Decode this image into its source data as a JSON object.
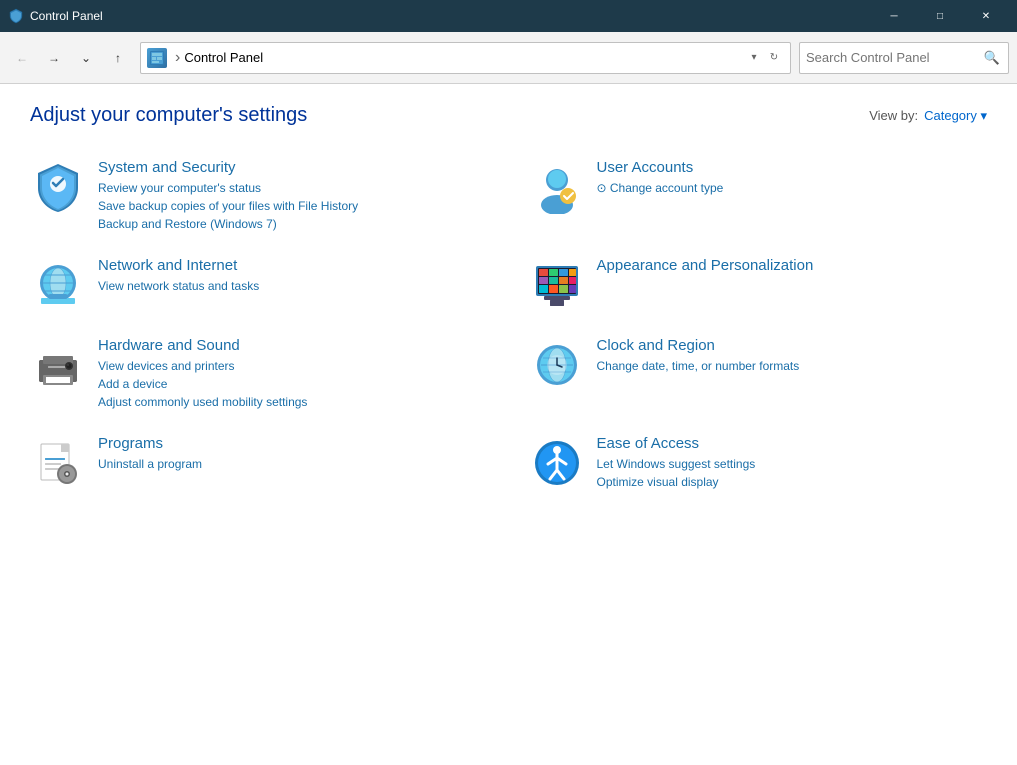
{
  "titlebar": {
    "title": "Control Panel",
    "icon": "🛡",
    "minimize_label": "─",
    "maximize_label": "□",
    "close_label": "✕"
  },
  "toolbar": {
    "back_tooltip": "Back",
    "forward_tooltip": "Forward",
    "recent_tooltip": "Recent pages",
    "up_tooltip": "Up",
    "address_icon": "CP",
    "address_separator": "›",
    "address_value": "Control Panel",
    "search_placeholder": "Search Control Panel"
  },
  "main": {
    "title": "Adjust your computer's settings",
    "view_by_label": "View by:",
    "view_by_value": "Category ▾",
    "categories": [
      {
        "name": "system-security",
        "title": "System and Security",
        "links": [
          "Review your computer's status",
          "Save backup copies of your files with File History",
          "Backup and Restore (Windows 7)"
        ]
      },
      {
        "name": "user-accounts",
        "title": "User Accounts",
        "links": [
          "⊙ Change account type"
        ]
      },
      {
        "name": "network-internet",
        "title": "Network and Internet",
        "links": [
          "View network status and tasks"
        ]
      },
      {
        "name": "appearance-personalization",
        "title": "Appearance and Personalization",
        "links": []
      },
      {
        "name": "hardware-sound",
        "title": "Hardware and Sound",
        "links": [
          "View devices and printers",
          "Add a device",
          "Adjust commonly used mobility settings"
        ]
      },
      {
        "name": "clock-region",
        "title": "Clock and Region",
        "links": [
          "Change date, time, or number formats"
        ]
      },
      {
        "name": "programs",
        "title": "Programs",
        "links": [
          "Uninstall a program"
        ]
      },
      {
        "name": "ease-of-access",
        "title": "Ease of Access",
        "links": [
          "Let Windows suggest settings",
          "Optimize visual display"
        ]
      }
    ]
  }
}
